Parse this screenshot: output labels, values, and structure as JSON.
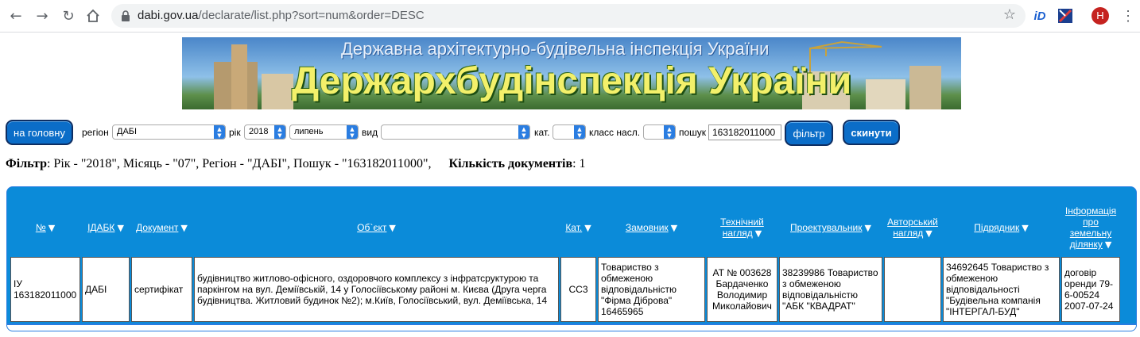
{
  "browser": {
    "url_host": "dabi.gov.ua",
    "url_path": "/declarate/list.php?sort=num&order=DESC",
    "profile_initial": "H",
    "ext1": "iD"
  },
  "banner": {
    "subtitle": "Державна архітектурно-будівельна інспекція України",
    "title": "Держархбудінспекція України"
  },
  "controls": {
    "home_button": "на головну",
    "region_label": "регіон",
    "region_value": "ДАБІ",
    "year_label": "рік",
    "year_value": "2018",
    "month_value": "липень",
    "type_label": "вид",
    "type_value": "",
    "cat_label": "кат.",
    "cat_value": "",
    "class_label": "класс насл.",
    "class_value": "",
    "search_label": "пошук",
    "search_value": "163182011000",
    "filter_button": "фільтр",
    "reset_button": "скинути"
  },
  "filter_summary": {
    "filter_label": "Фільтр",
    "filter_text": ": Рік - \"2018\", Місяць - \"07\", Регіон - \"ДАБІ\", Пошук - \"163182011000\",",
    "count_label": "Кількість документів",
    "count_value": ": 1"
  },
  "table": {
    "headers": [
      "№",
      "ІДАБК",
      "Документ",
      "Об`єкт",
      "Кат.",
      "Замовник",
      "Технічний нагляд",
      "Проектувальник",
      "Авторський нагляд",
      "Підрядник",
      "Інформація про земельну ділянку"
    ],
    "rows": [
      {
        "num": "ІУ 163182011000",
        "idabk": "ДАБІ",
        "document": "сертифікат",
        "object": "будівництво житлово-офісного, оздоровчого комплексу з інфратсруктурою та паркінгом на вул. Деміївській, 14 у Голосіївському районі м. Києва (Друга черга будівництва. Житловий будинок №2); м.Київ, Голосіївський, вул. Деміївська, 14",
        "cat": "СС3",
        "customer": "Товариство з обмеженою відповідальністю \"Фірма Діброва\" 16465965",
        "tech_supervision": "АТ № 003628 Бардаченко Володимир Миколайович",
        "designer": "38239986 Товариство з обмеженою відповідальністю \"АБК \"КВАДРАТ\"",
        "author_supervision": "",
        "contractor": "34692645 Товариство з обмеженою відповідальності \"Будівельна компанія \"ІНТЕРГАЛ-БУД\"",
        "land_info": "договір оренди 79-6-00524 2007-07-24"
      }
    ]
  }
}
